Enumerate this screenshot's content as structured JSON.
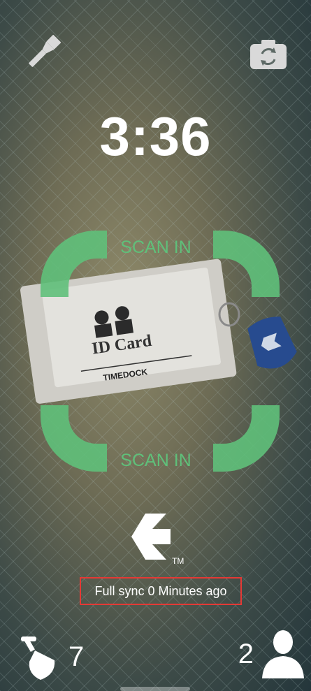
{
  "timer": {
    "value": "3:36"
  },
  "scanner": {
    "top_label": "SCAN IN",
    "bottom_label": "SCAN IN",
    "bracket_color": "#5fc07a"
  },
  "photo": {
    "card_title": "ID Card",
    "brand_text": "TIMEDOCK"
  },
  "logo": {
    "trademark": "TM"
  },
  "sync_status": {
    "text": "Full sync 0 Minutes ago",
    "highlight_color": "#e53935"
  },
  "footer": {
    "job_count": "7",
    "user_count": "2"
  },
  "icons": {
    "top_left": "flashlight-icon",
    "top_right": "camera-switch-icon",
    "bottom_left": "shovel-icon",
    "bottom_right": "user-icon"
  }
}
